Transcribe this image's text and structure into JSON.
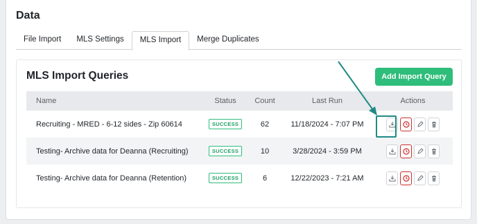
{
  "page": {
    "title": "Data"
  },
  "tabs": [
    {
      "label": "File Import",
      "active": false
    },
    {
      "label": "MLS Settings",
      "active": false
    },
    {
      "label": "MLS Import",
      "active": true
    },
    {
      "label": "Merge Duplicates",
      "active": false
    }
  ],
  "section": {
    "title": "MLS Import Queries",
    "add_button": "Add Import Query"
  },
  "table": {
    "headers": {
      "name": "Name",
      "status": "Status",
      "count": "Count",
      "last_run": "Last Run",
      "actions": "Actions"
    },
    "rows": [
      {
        "name": "Recruiting - MRED - 6-12 sides - Zip 60614",
        "status": "SUCCESS",
        "count": "62",
        "last_run": "11/18/2024 - 7:07 PM"
      },
      {
        "name": "Testing- Archive data for Deanna (Recruiting)",
        "status": "SUCCESS",
        "count": "10",
        "last_run": "3/28/2024 - 3:59 PM"
      },
      {
        "name": "Testing- Archive data for Deanna (Retention)",
        "status": "SUCCESS",
        "count": "6",
        "last_run": "12/22/2023 - 7:21 AM"
      }
    ]
  },
  "icons": {
    "import": "import-tray-icon",
    "history": "clock-icon",
    "edit": "pencil-icon",
    "delete": "trash-icon"
  },
  "colors": {
    "accent": "#2ebd7a",
    "danger": "#c9302c",
    "annotation": "#1f8a84"
  }
}
